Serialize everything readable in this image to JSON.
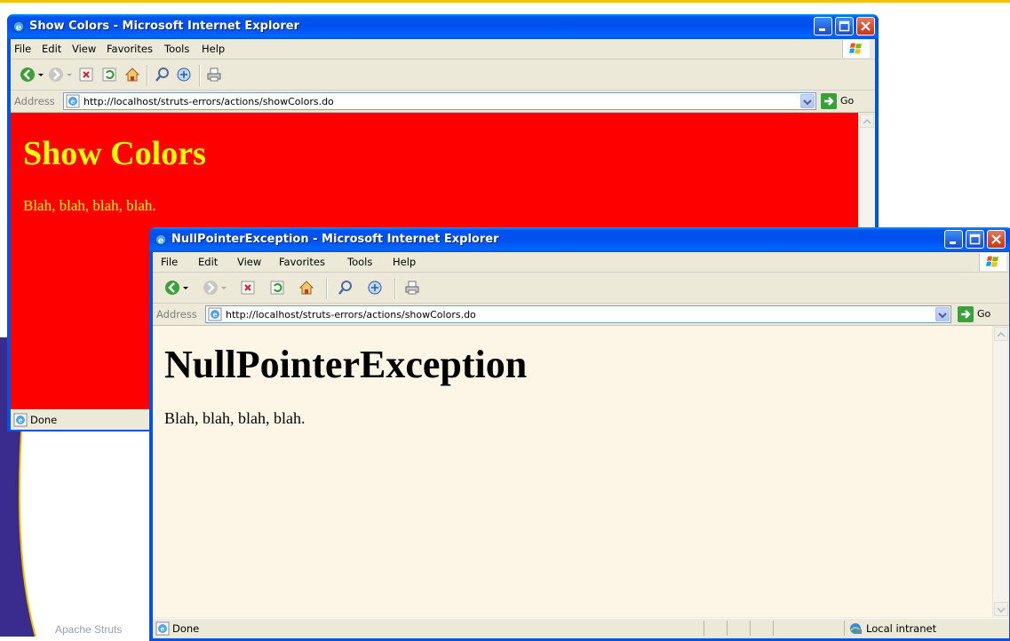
{
  "slide": {
    "footer": "Apache Struts",
    "colors": {
      "purple_band": "#3a2c8e",
      "gold_line": "#f2c200"
    }
  },
  "window_back": {
    "title": "Show Colors - Microsoft Internet Explorer",
    "menu": [
      "File",
      "Edit",
      "View",
      "Favorites",
      "Tools",
      "Help"
    ],
    "address_label": "Address",
    "url": "http://localhost/struts-errors/actions/showColors.do",
    "go_label": "Go",
    "page": {
      "heading": "Show Colors",
      "body": "Blah, blah, blah, blah.",
      "bg_color": "#ff0000",
      "text_color": "#ffff00"
    },
    "status": "Done"
  },
  "window_front": {
    "title": "NullPointerException - Microsoft Internet Explorer",
    "menu": [
      "File",
      "Edit",
      "View",
      "Favorites",
      "Tools",
      "Help"
    ],
    "address_label": "Address",
    "url": "http://localhost/struts-errors/actions/showColors.do",
    "go_label": "Go",
    "page": {
      "heading": "NullPointerException",
      "body": "Blah, blah, blah, blah.",
      "bg_color": "#fdf5e6",
      "text_color": "#000000"
    },
    "status": "Done",
    "zone": "Local intranet"
  },
  "toolbar_icons": [
    "back-icon",
    "back-dropdown-icon",
    "forward-icon",
    "forward-dropdown-icon",
    "stop-icon",
    "refresh-icon",
    "home-icon",
    "search-icon",
    "favorites-icon",
    "print-icon"
  ]
}
